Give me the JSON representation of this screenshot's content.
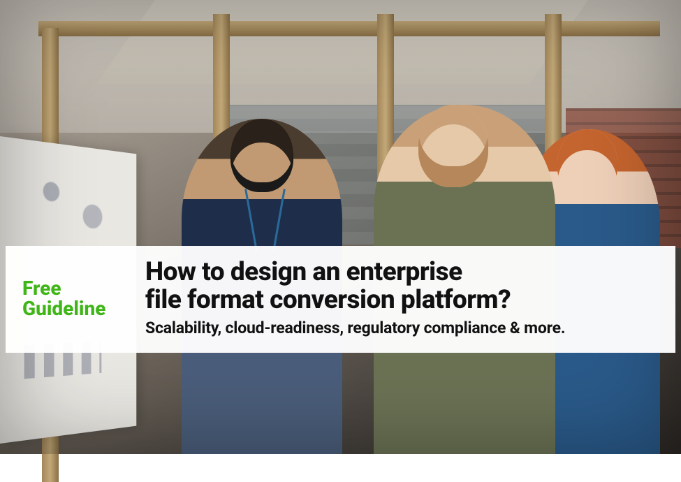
{
  "banner": {
    "badge_line1": "Free",
    "badge_line2": "Guideline",
    "headline_line1": "How to design an enterprise",
    "headline_line2": "file format conversion platform?",
    "subhead": "Scalability, cloud-readiness, regulatory compliance & more."
  },
  "colors": {
    "badge_green": "#3fb618",
    "text_black": "#111111",
    "banner_bg": "rgba(255,255,255,0.96)"
  }
}
